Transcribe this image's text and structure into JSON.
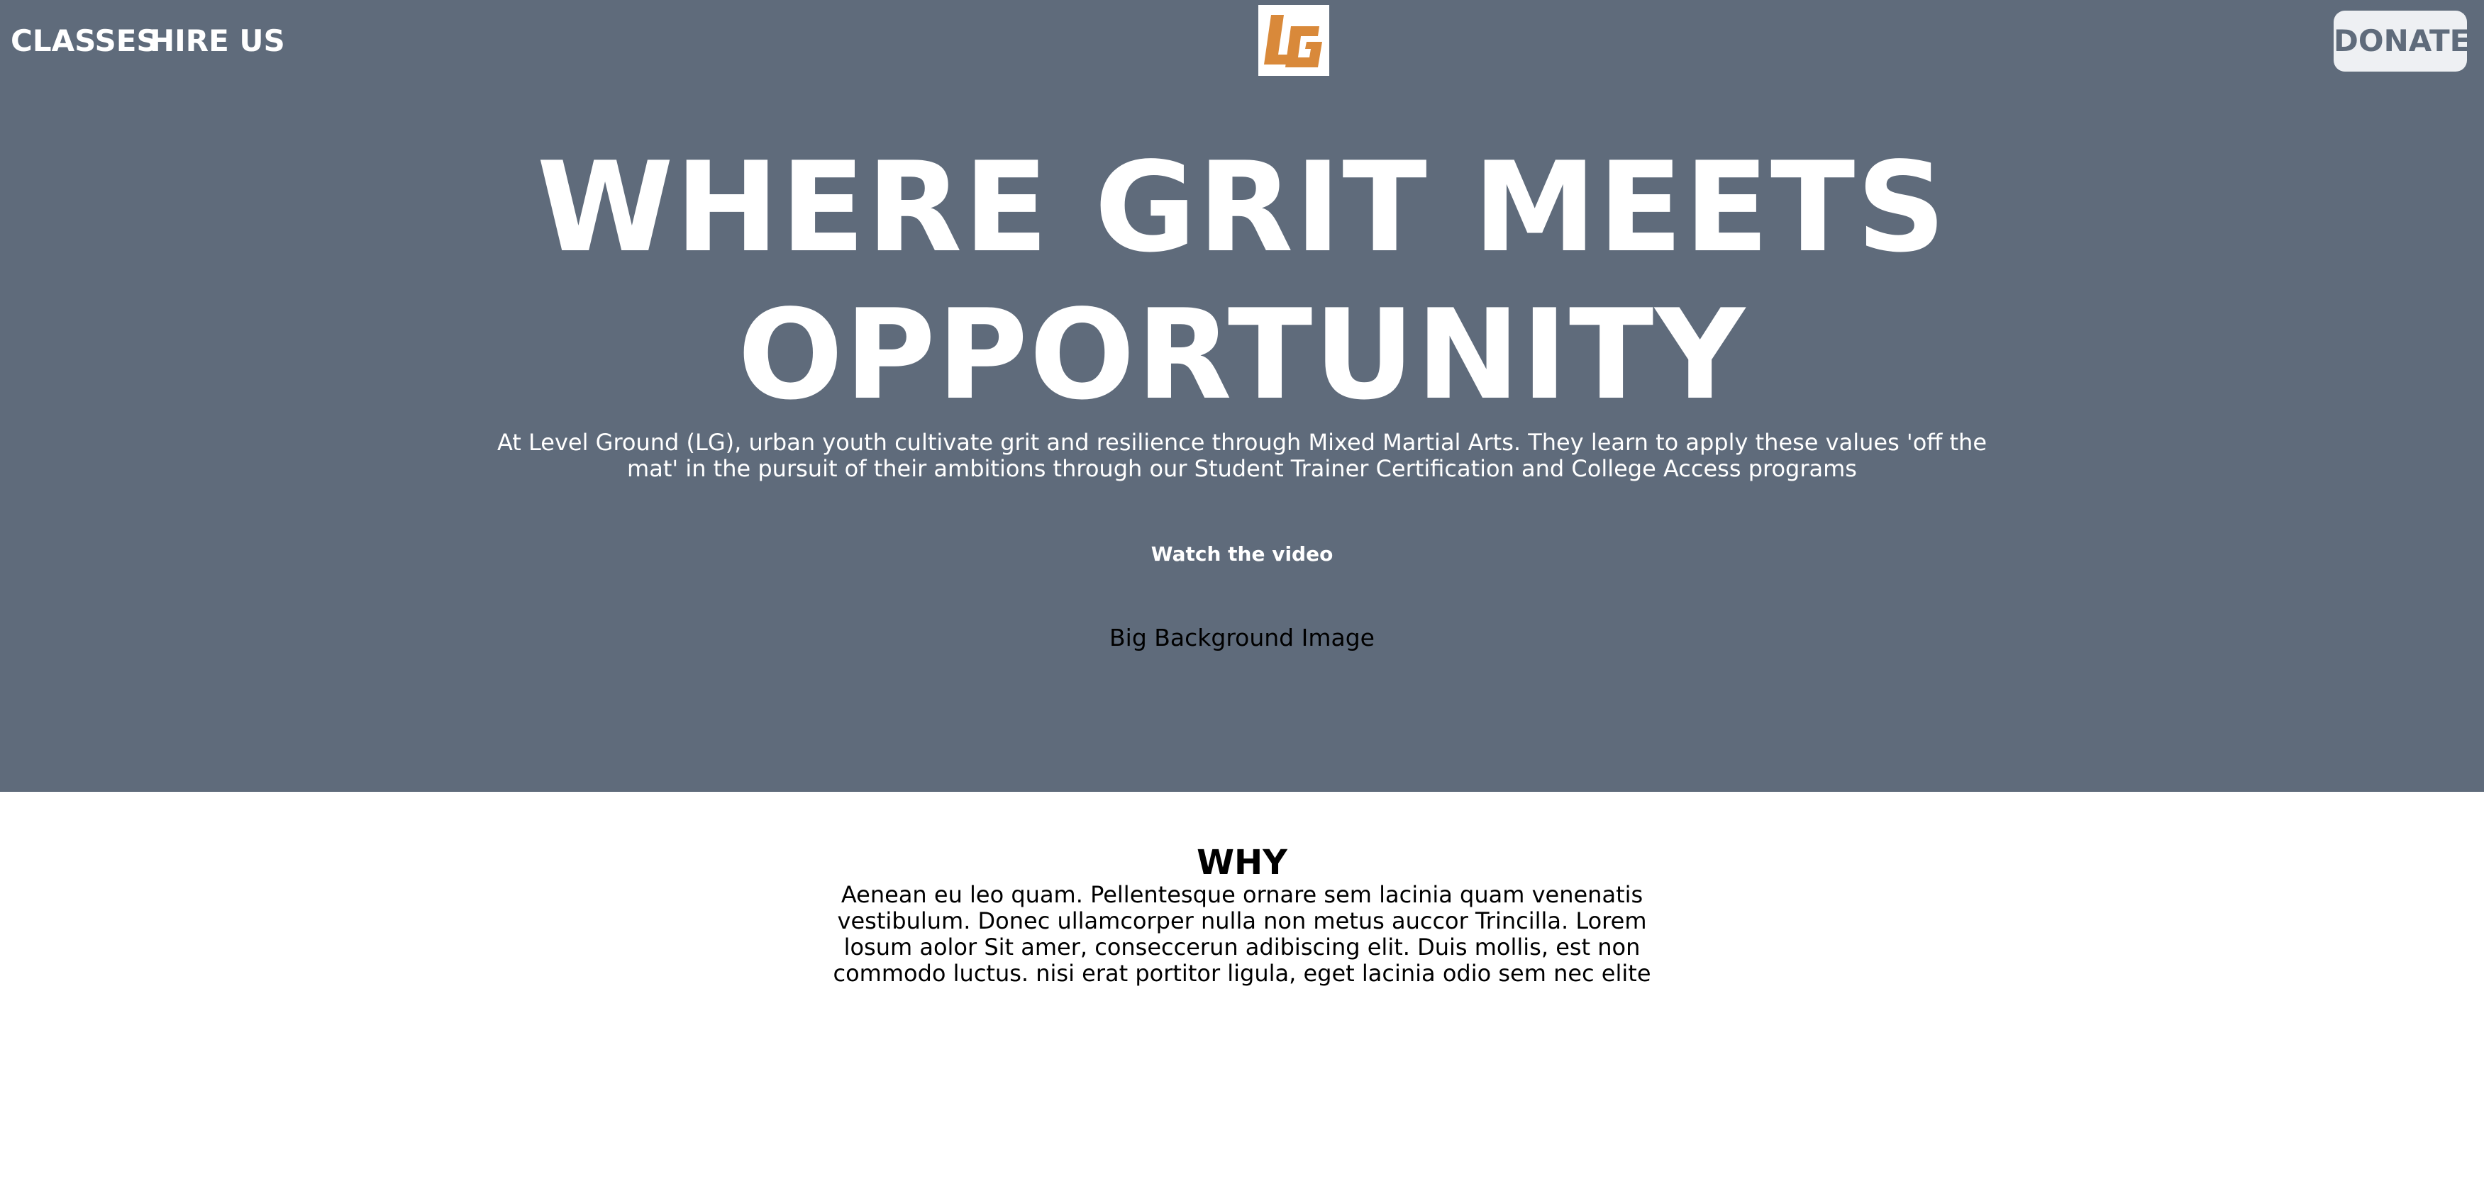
{
  "nav": {
    "left_links": [
      "CLASSES",
      "HIRE US"
    ],
    "logo_text": "LG",
    "donate_label": "DONATE"
  },
  "hero": {
    "title_line1": "WHERE GRIT MEETS",
    "title_line2": "OPPORTUNITY",
    "description": "At Level Ground (LG), urban youth cultivate grit and resilience through Mixed Martial Arts. They learn to apply these values 'off the mat' in the pursuit of their ambitions through our Student Trainer Certification and College Access programs",
    "video_link": "Watch the video",
    "background_label": "Big Background Image"
  },
  "why": {
    "heading": "WHY",
    "body": "Aenean eu leo quam. Pellentesque ornare sem lacinia quam venenatis vestibulum. Donec ullamcorper nulla non metus auccor Trincilla. Lorem losum aolor Sit amer, conseccerun adibiscing elit. Duis mollis, est non commodo luctus. nisi erat portitor ligula, eget lacinia odio sem nec elite"
  },
  "colors": {
    "hero_background": "#5f6b7b",
    "logo_orange": "#d9893a",
    "donate_background": "#eef0f3"
  }
}
